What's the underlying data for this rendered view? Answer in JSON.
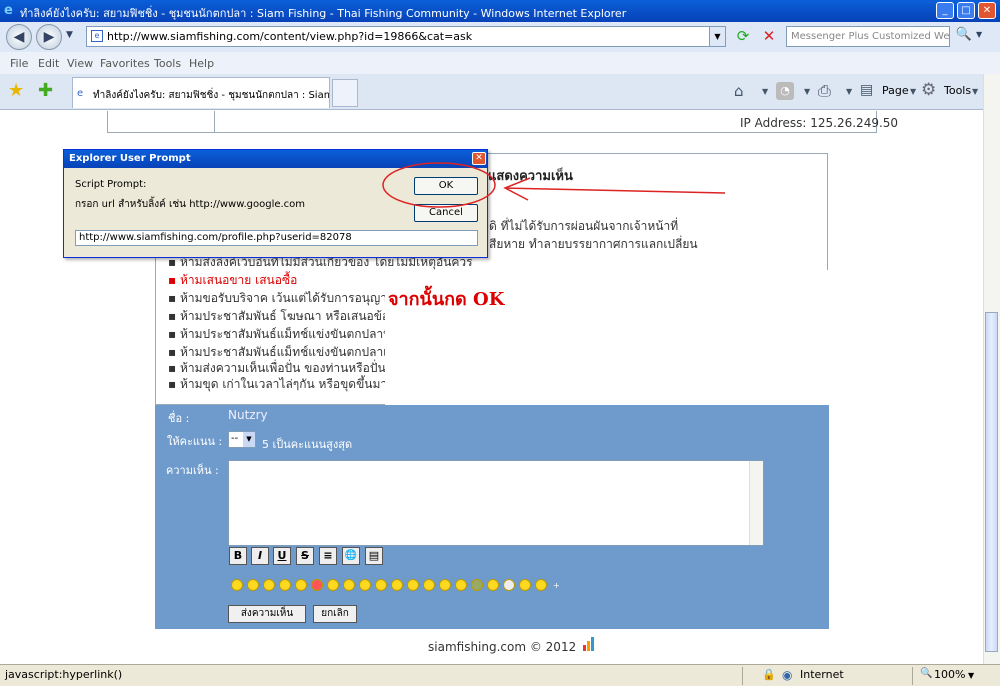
{
  "window": {
    "title": "ทำลิงค์ยังไงครับ: สยามฟิชชิ่ง - ชุมชนนักตกปลา : Siam Fishing - Thai Fishing Community - Windows Internet Explorer"
  },
  "address": {
    "url": "http://www.siamfishing.com/content/view.php?id=19866&cat=ask",
    "search_placeholder": "Messenger Plus Customized Web Sear"
  },
  "menu": [
    "File",
    "Edit",
    "View",
    "Favorites",
    "Tools",
    "Help"
  ],
  "tab": {
    "label": "ทำลิงค์ยังไงครับ: สยามฟิชชิ่ง - ชุมชนนักตกปลา : Siam Fi..."
  },
  "toolbar": {
    "page_label": "Page",
    "tools_label": "Tools"
  },
  "content": {
    "ip_label": "IP Address:",
    "ip_value": "125.26.249.50",
    "section_title": "แสดงความเห็น",
    "rule_line1": "ดิ ที่ไม่ได้รับการผ่อนผันจากเจ้าหน้าที่",
    "rule_line2": "สียหาย ทำลายบรรยากาศการแลกเปลี่ยน",
    "rules": [
      "ห้ามส่งลิงค์เว็บอื่นที่ไม่มีส่วนเกี่ยวข้อง โดยไม่มีเหตุอันควร",
      "ห้ามเสนอขาย เสนอซื้อ",
      "ห้ามขอรับบริจาค เว้นแต่ได้รับการอนุญาต",
      "ห้ามประชาสัมพันธ์ โฆษณา หรือเสนอข้อ",
      "ห้ามประชาสัมพันธ์แม็ทช์แข่งขันตกปลาที่",
      "ห้ามประชาสัมพันธ์แม็ทช์แข่งขันตกปลาเ",
      "ห้ามส่งความเห็นเพื่อปั่น ของท่านหรือปั่น",
      "ห้ามขุด เก่าในเวลาไล่ๆกัน หรือขุดขึ้นมา"
    ],
    "annotation": "จากนั้นกด OK"
  },
  "form": {
    "name_label": "ชื่อ :",
    "name_value": "Nutzry",
    "score_label": "ให้คะแนน :",
    "score_value": "--",
    "score_hint": "5 เป็นคะแนนสูงสุด",
    "comment_label": "ความเห็น :",
    "toolbar": [
      "B",
      "I",
      "U",
      "S",
      "≡",
      "🌐",
      "▤"
    ],
    "submit_label": "ส่งความเห็น",
    "cancel_label": "ยกเลิก"
  },
  "footer": {
    "text": "siamfishing.com © 2012"
  },
  "dialog": {
    "title": "Explorer User Prompt",
    "script_prompt": "Script Prompt:",
    "message": "กรอก url สำหรับลิ้งค์ เช่น http://www.google.com",
    "ok_label": "OK",
    "cancel_label": "Cancel",
    "input_value": "http://www.siamfishing.com/profile.php?userid=82078"
  },
  "status": {
    "text": "javascript:hyperlink()",
    "zone": "Internet",
    "zoom": "100%"
  },
  "colors": {
    "form_bg": "#6f9bcc",
    "annotation": "#dd0000",
    "xp_blue": "#0a5fd8"
  }
}
